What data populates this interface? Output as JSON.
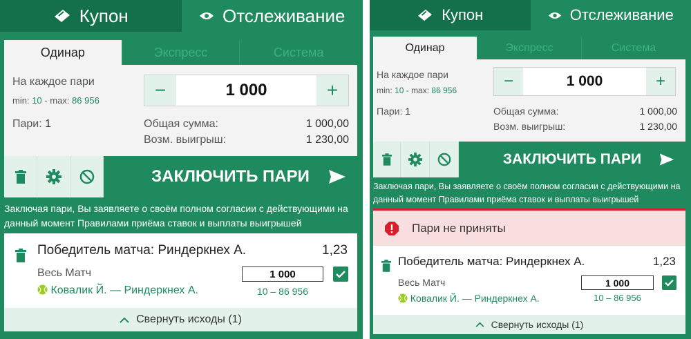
{
  "header": {
    "coupon_label": "Купон",
    "tracking_label": "Отслеживание"
  },
  "subtabs": [
    "Одинар",
    "Экспресс",
    "Система"
  ],
  "stake": {
    "per_bet_label": "На каждое пари",
    "min_label": "min:",
    "min_value": "10",
    "sep": "-",
    "max_label": "max:",
    "max_value": "86 956",
    "amount": "1 000",
    "minus": "−",
    "plus": "+"
  },
  "summary": {
    "bets_label": "Пари:",
    "bets_value": "1",
    "total_label": "Общая сумма:",
    "total_value": "1 000,00",
    "win_label": "Возм. выигрыш:",
    "win_value": "1 230,00"
  },
  "actions": {
    "place_label": "ЗАКЛЮЧИТЬ ПАРИ",
    "icons": [
      "trash-icon",
      "gear-icon",
      "ban-icon",
      "send-icon"
    ]
  },
  "notice": {
    "line1": "Заключая пари, Вы заявляете о своём полном согласии с действующими на",
    "line2_prefix": "данный момент ",
    "line2_link": "Правилами приёма ставок и выплаты выигрышей"
  },
  "error": {
    "message": "Пари не приняты"
  },
  "bet": {
    "title": "Победитель матча: Риндеркнех А.",
    "odds": "1,23",
    "period": "Весь Матч",
    "stake": "1 000",
    "match": "Ковалик Й. — Риндеркнех А.",
    "range": "10 – 86 956"
  },
  "collapse": {
    "label": "Свернуть исходы",
    "count": "(1)"
  },
  "colors": {
    "brand_green": "#1f8a5e",
    "dark_green": "#14704a",
    "light_green": "#e2f2ea",
    "error_red": "#d61f2a",
    "error_bg": "#f8dede"
  }
}
